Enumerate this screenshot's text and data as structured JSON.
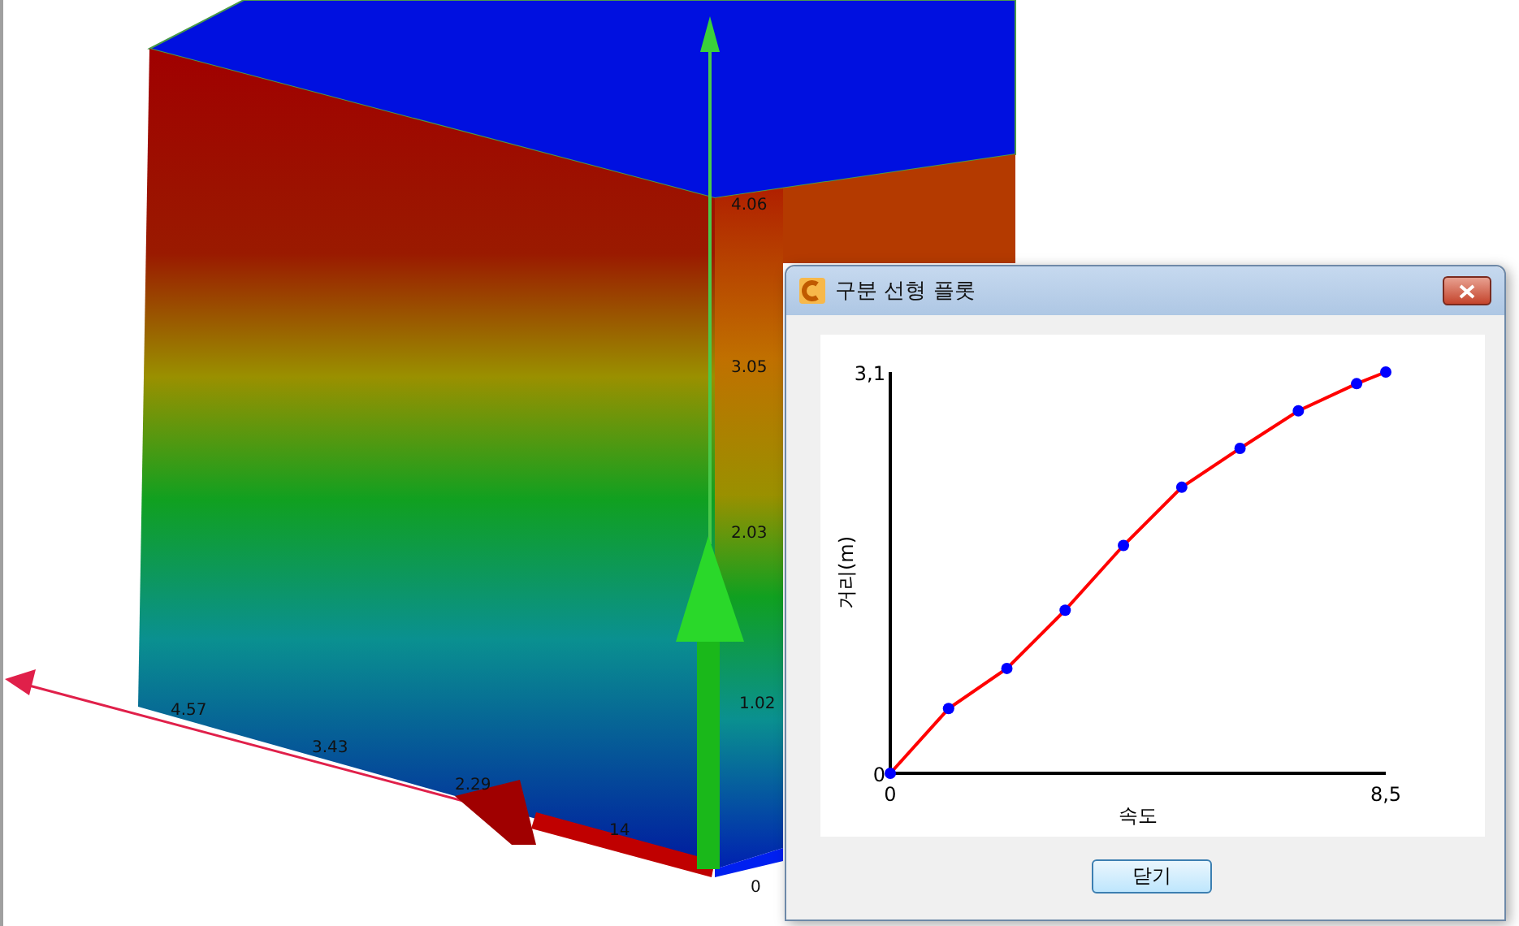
{
  "viewport": {
    "vertical_axis_labels": [
      "4.06",
      "3.05",
      "2.03",
      "1.02",
      "0"
    ],
    "horizontal_axis_labels": [
      "4.57",
      "3.43",
      "2.29",
      "14"
    ]
  },
  "dialog": {
    "title": "구분 선형 플롯",
    "close_button": "닫기",
    "chart_data": {
      "type": "line",
      "xlabel": "속도",
      "ylabel": "거리(m)",
      "xlim": [
        0,
        8.5
      ],
      "ylim": [
        0,
        3.1
      ],
      "xticks": [
        {
          "value": 0,
          "label": "0"
        },
        {
          "value": 8.5,
          "label": "8,5"
        }
      ],
      "yticks": [
        {
          "value": 0,
          "label": "0"
        },
        {
          "value": 3.1,
          "label": "3,1"
        }
      ],
      "x": [
        0,
        1,
        2,
        3,
        4,
        5,
        6,
        7,
        8,
        8.5
      ],
      "series": [
        {
          "color": "#ff0000",
          "marker": "o",
          "values": [
            0,
            0.5,
            0.81,
            1.26,
            1.76,
            2.21,
            2.51,
            2.8,
            3.01,
            3.1
          ]
        }
      ]
    }
  }
}
